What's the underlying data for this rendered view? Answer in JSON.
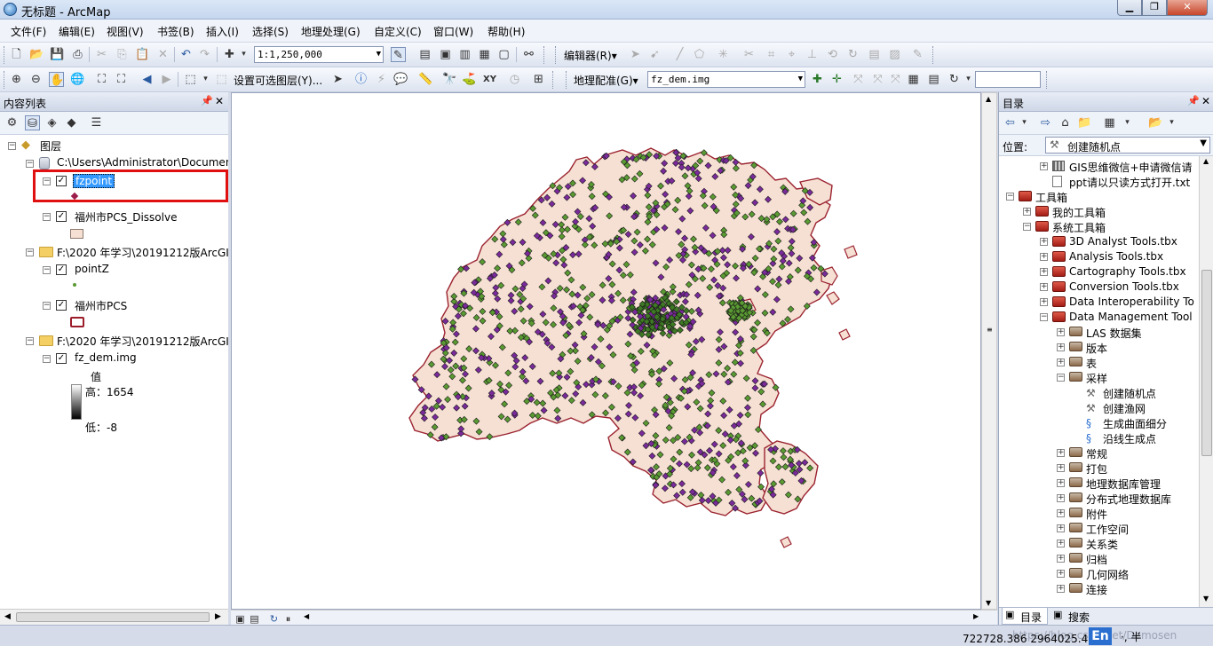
{
  "window": {
    "title": "无标题 - ArcMap"
  },
  "menu": [
    "文件(F)",
    "编辑(E)",
    "视图(V)",
    "书签(B)",
    "插入(I)",
    "选择(S)",
    "地理处理(G)",
    "自定义(C)",
    "窗口(W)",
    "帮助(H)"
  ],
  "toolbar1": {
    "scale": "1:1,250,000",
    "editor_label": "编辑器(R)▾"
  },
  "toolbar2": {
    "selectable_label": "设置可选图层(Y)...",
    "georef_label": "地理配准(G)▾",
    "georef_layer": "fz_dem.img"
  },
  "toc": {
    "title": "内容列表",
    "root": "图层",
    "items": [
      {
        "path": "C:\\Users\\Administrator\\Documen"
      },
      {
        "layer": "fzpoint"
      },
      {
        "layer": "福州市PCS_Dissolve"
      },
      {
        "path": "F:\\2020 年学习\\20191212版ArcGI"
      },
      {
        "layer": "pointZ"
      },
      {
        "layer": "福州市PCS"
      },
      {
        "path": "F:\\2020 年学习\\20191212版ArcGI"
      },
      {
        "layer": "fz_dem.img"
      }
    ],
    "legend": {
      "value_label": "值",
      "high": "高：1654",
      "low": "低：-8"
    }
  },
  "catalog": {
    "title": "目录",
    "location_label": "位置:",
    "location_value": "创建随机点",
    "items": [
      "GIS思维微信+申请微信请",
      "ppt请以只读方式打开.txt",
      "工具箱",
      "我的工具箱",
      "系统工具箱",
      "3D Analyst Tools.tbx",
      "Analysis Tools.tbx",
      "Cartography Tools.tbx",
      "Conversion Tools.tbx",
      "Data Interoperability To",
      "Data Management Tool",
      "LAS 数据集",
      "版本",
      "表",
      "采样",
      "创建随机点",
      "创建渔网",
      "生成曲面细分",
      "沿线生成点",
      "常规",
      "打包",
      "地理数据库管理",
      "分布式地理数据库",
      "附件",
      "工作空间",
      "关系类",
      "归档",
      "几何网络",
      "连接"
    ],
    "tabs": [
      "目录",
      "搜索"
    ]
  },
  "status": {
    "coords": "722728.386   2964025.46 米",
    "watermark": "https://blog.csdn.net/Demosen"
  },
  "colors": {
    "polygon_fill": "#f6e0d3",
    "polygon_outline": "#9b2330",
    "point_green": "#5a9a32",
    "point_purple": "#7a2a9a",
    "selection": "#3399ff",
    "highlight_box": "#e01010"
  }
}
